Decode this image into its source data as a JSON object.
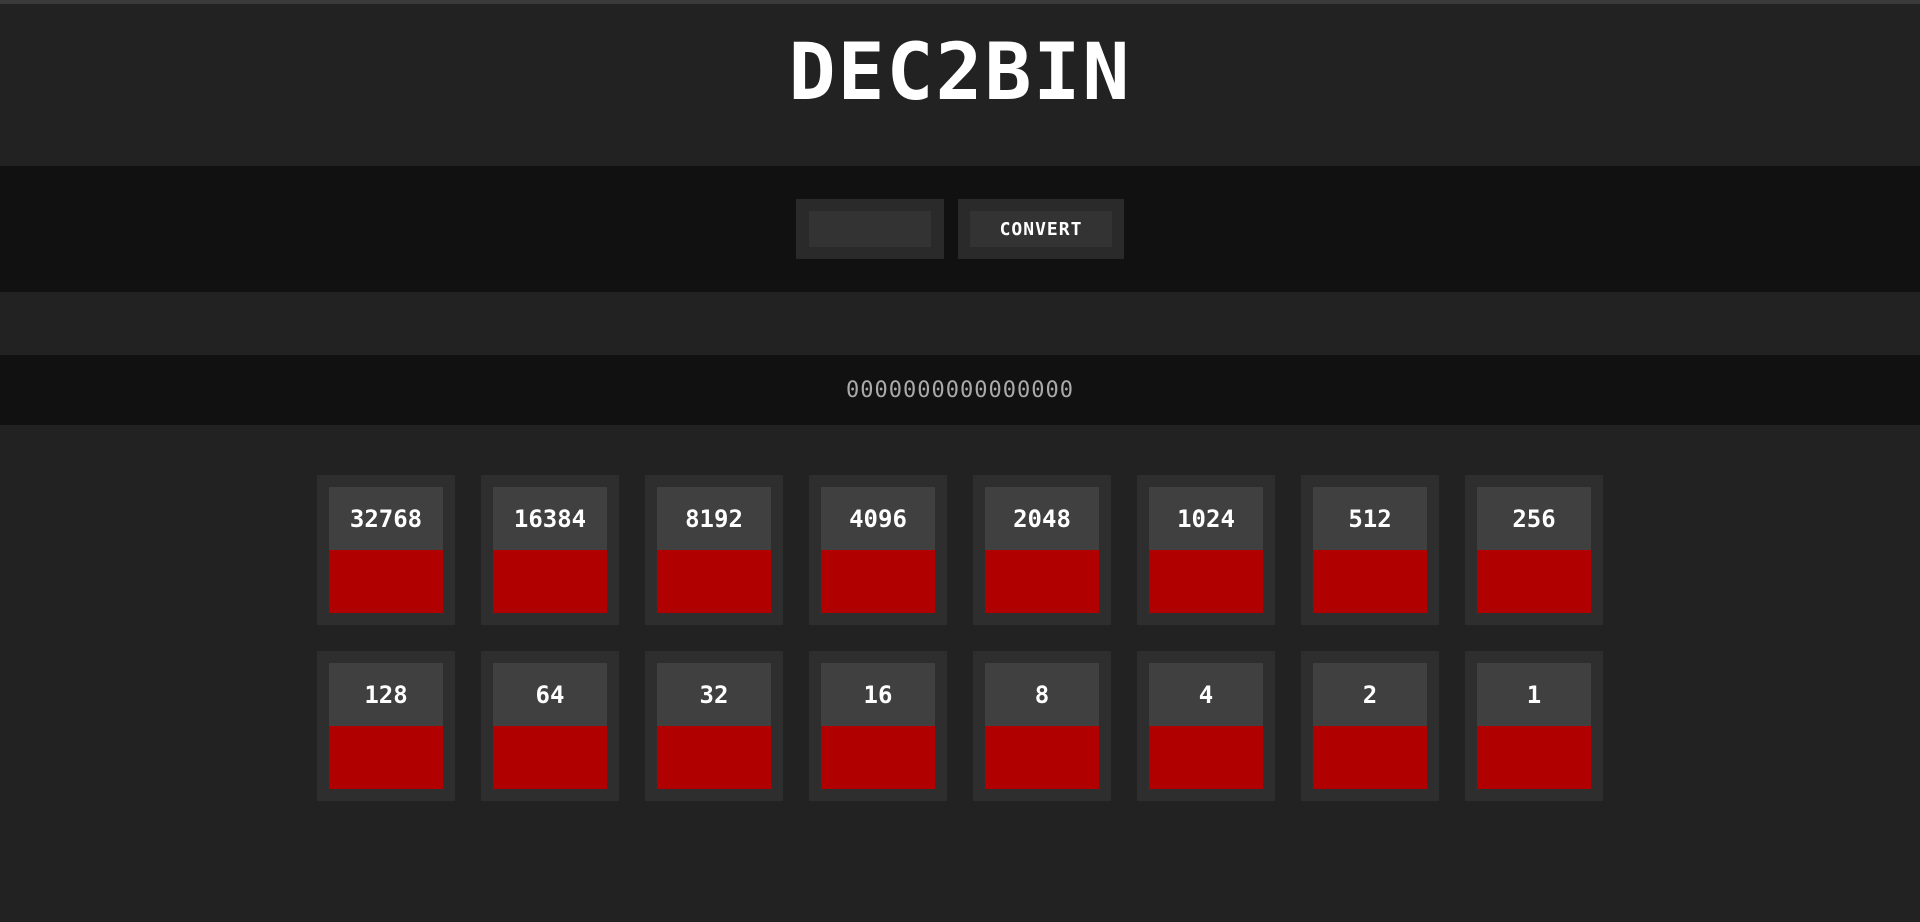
{
  "header": {
    "title": "DEC2BIN"
  },
  "converter": {
    "input_value": "",
    "input_placeholder": "",
    "convert_label": "CONVERT"
  },
  "result": {
    "binary": "0000000000000000"
  },
  "bits": {
    "row1": [
      {
        "label": "32768",
        "state": "off"
      },
      {
        "label": "16384",
        "state": "off"
      },
      {
        "label": "8192",
        "state": "off"
      },
      {
        "label": "4096",
        "state": "off"
      },
      {
        "label": "2048",
        "state": "off"
      },
      {
        "label": "1024",
        "state": "off"
      },
      {
        "label": "512",
        "state": "off"
      },
      {
        "label": "256",
        "state": "off"
      }
    ],
    "row2": [
      {
        "label": "128",
        "state": "off"
      },
      {
        "label": "64",
        "state": "off"
      },
      {
        "label": "32",
        "state": "off"
      },
      {
        "label": "16",
        "state": "off"
      },
      {
        "label": "8",
        "state": "off"
      },
      {
        "label": "4",
        "state": "off"
      },
      {
        "label": "2",
        "state": "off"
      },
      {
        "label": "1",
        "state": "off"
      }
    ]
  },
  "colors": {
    "off": "#b00000",
    "on": "#00b000",
    "background": "#222222",
    "band": "#111111"
  }
}
